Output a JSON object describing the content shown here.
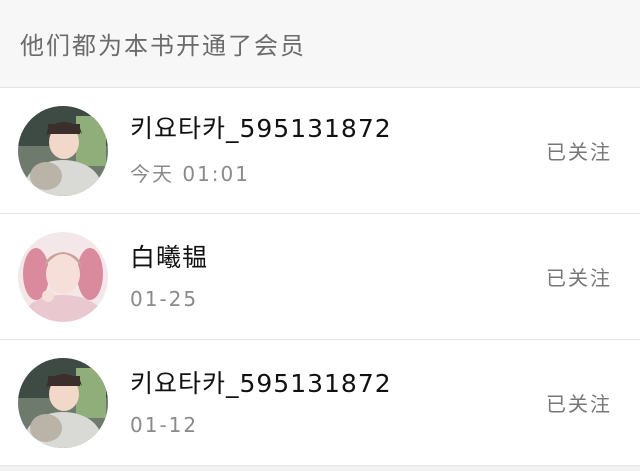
{
  "header": {
    "title": "他们都为本书开通了会员"
  },
  "members": [
    {
      "name": "키요타카_595131872",
      "time": "今天 01:01",
      "follow_label": "已关注",
      "avatar": "male-hoodie-avatar"
    },
    {
      "name": "白曦韫",
      "time": "01-25",
      "follow_label": "已关注",
      "avatar": "girl-pink-avatar"
    },
    {
      "name": "키요타카_595131872",
      "time": "01-12",
      "follow_label": "已关注",
      "avatar": "male-hoodie-avatar"
    }
  ],
  "colors": {
    "header_bg": "#f7f7f7",
    "row_bg": "#ffffff",
    "divider": "#e6e6e6",
    "name_text": "#111111",
    "meta_text": "#8a8a8a",
    "follow_text": "#777777"
  }
}
